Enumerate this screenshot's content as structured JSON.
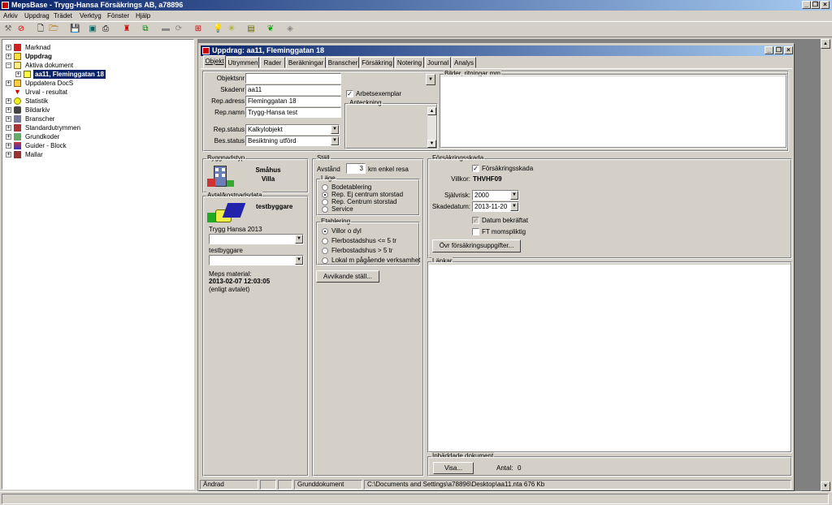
{
  "app": {
    "title": "MepsBase - Trygg-Hansa Försäkrings AB, a78896"
  },
  "menu": [
    "Arkiv",
    "Uppdrag",
    "Trädet",
    "Verktyg",
    "Fönster",
    "Hjälp"
  ],
  "tree": {
    "items": [
      {
        "label": "Marknad",
        "icon": "market-icon",
        "bold": false
      },
      {
        "label": "Uppdrag",
        "icon": "folder-icon",
        "bold": true
      },
      {
        "label": "Aktiva dokument",
        "icon": "open-folder-icon",
        "bold": false
      },
      {
        "label": "aa11, Fleminggatan 18",
        "icon": "document-icon",
        "bold": true,
        "selected": true
      },
      {
        "label": "Uppdatera DocS",
        "icon": "update-icon",
        "bold": false
      },
      {
        "label": "Urval - resultat",
        "icon": "filter-icon",
        "bold": false
      },
      {
        "label": "Statistik",
        "icon": "pie-chart-icon",
        "bold": false
      },
      {
        "label": "Bildarkiv",
        "icon": "camera-icon",
        "bold": false
      },
      {
        "label": "Branscher",
        "icon": "building-icon",
        "bold": false
      },
      {
        "label": "Standardutrymmen",
        "icon": "room-icon",
        "bold": false
      },
      {
        "label": "Grundkoder",
        "icon": "code-icon",
        "bold": false
      },
      {
        "label": "Guider - Block",
        "icon": "guide-icon",
        "bold": false
      },
      {
        "label": "Mallar",
        "icon": "template-icon",
        "bold": false
      }
    ]
  },
  "doc": {
    "title": "Uppdrag: aa11, Fleminggatan 18",
    "tabs": [
      "Objekt",
      "Utrymmen",
      "Rader",
      "Beräkningar",
      "Branscher",
      "Försäkring",
      "Notering",
      "Journal",
      "Analys"
    ],
    "fields": {
      "objektsnr_label": "Objektsnr",
      "objektsnr_value": "",
      "skadenr_label": "Skadenr",
      "skadenr_value": "aa11",
      "rep_adress_label": "Rep.adress",
      "rep_adress_value": "Fleminggatan 18",
      "rep_namn_label": "Rep.namn",
      "rep_namn_value": "Trygg-Hansa test",
      "rep_status_label": "Rep.status",
      "rep_status_value": "Kalkylobjekt",
      "bes_status_label": "Bes.status",
      "bes_status_value": "Besiktning utförd"
    },
    "arbetsexemplar": "Arbetsexemplar",
    "anteckning": "Anteckning",
    "bilder": "Bilder, ritningar mm",
    "byggnadstyp": {
      "label": "Byggnadstyp",
      "line1": "Småhus",
      "line2": "Villa"
    },
    "avtal": {
      "label": "Avtal/kostnadsdata",
      "name": "testbyggare",
      "select1_label": "Trygg Hansa 2013",
      "select2_label": "testbyggare",
      "material_label": "Meps material:",
      "material_date": "2013-02-07 12:03:05",
      "material_note": "(enligt avtalet)"
    },
    "stall": {
      "label": "Ställ",
      "avstand_label": "Avstånd",
      "avstand_value": "3",
      "avstand_unit": "km enkel resa",
      "lage_label": "Läge",
      "lage_options": [
        "Bodetablering",
        "Rep. Ej centrum storstad",
        "Rep. Centrum storstad",
        "Service"
      ],
      "lage_selected": 1,
      "etablering_label": "Etablering",
      "etablering_options": [
        "Villor o dyl",
        "Flerbostadshus <= 5 tr",
        "Flerbostadshus > 5 tr",
        "Lokal m pågående verksamhet"
      ],
      "etablering_selected": 0,
      "avvikande_button": "Avvikande ställ..."
    },
    "forsakring": {
      "label": "Försäkringsskada",
      "checkbox": "Försäkringsskada",
      "villkor_label": "Villkor:",
      "villkor_value": "THVHF09",
      "sjalvrisk_label": "Självrisk:",
      "sjalvrisk_value": "2000",
      "skadedatum_label": "Skadedatum:",
      "skadedatum_value": "2013-11-20",
      "datum_bekraftat": "Datum bekräftat",
      "ft_momspliktig": "FT momspliktig",
      "ovr_button": "Övr försäkringsuppgifter..."
    },
    "lankar": "Länkar",
    "inbaddade": {
      "label": "Inbäddade dokument",
      "visa_button": "Visa...",
      "antal_label": "Antal:",
      "antal_value": "0"
    },
    "status": {
      "p1": "Ändrad",
      "p2": "",
      "p3": "",
      "p4": "Grunddokument",
      "p5": "C:\\Documents and Settings\\a78896\\Desktop\\aa11.nta  676 Kb"
    }
  }
}
